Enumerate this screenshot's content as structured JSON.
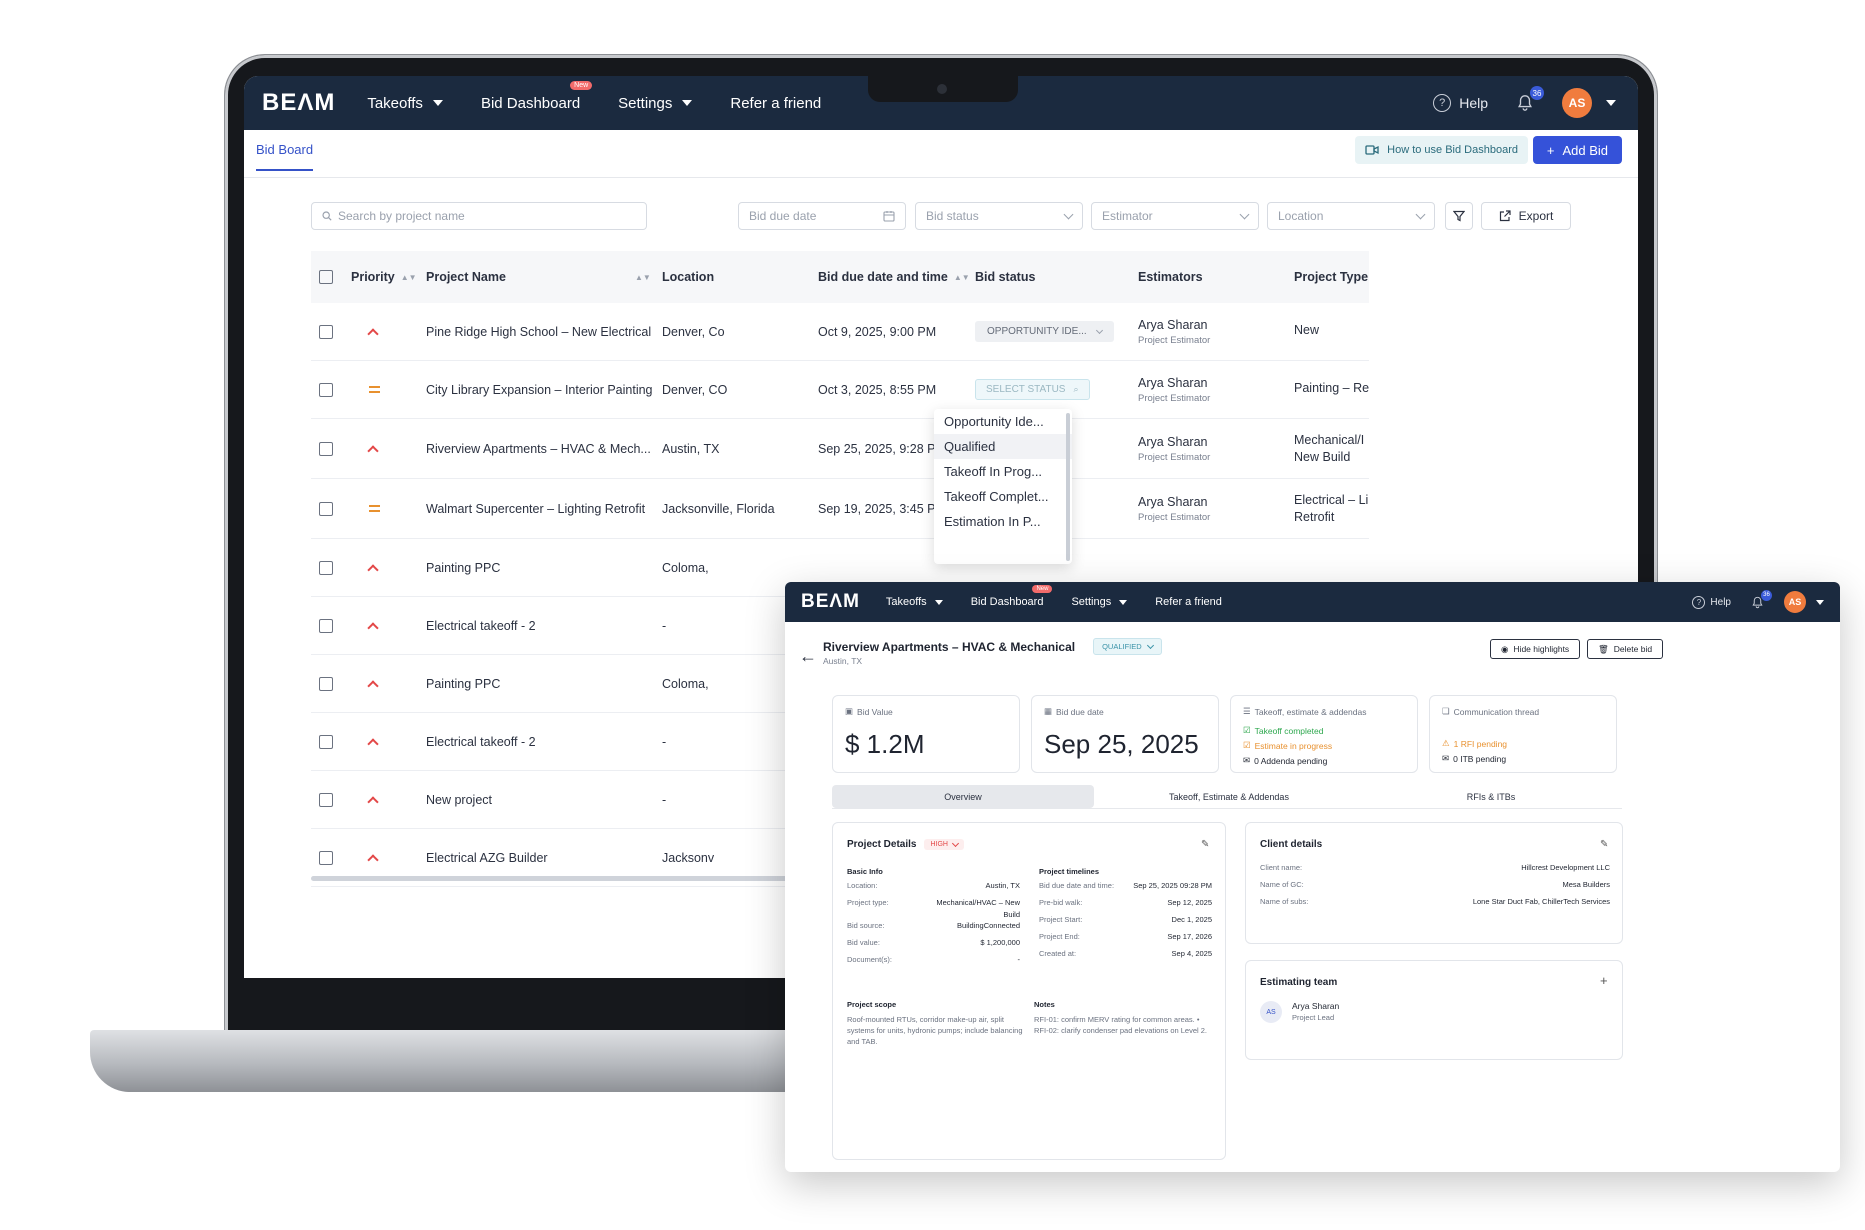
{
  "brand": {
    "logo": "BEΛM"
  },
  "nav": {
    "takeoffs": "Takeoffs",
    "bid_dashboard": "Bid Dashboard",
    "new_badge": "New",
    "settings": "Settings",
    "refer": "Refer a friend",
    "help": "Help",
    "help_glyph": "?",
    "notif_count": "36",
    "user_initials": "AS"
  },
  "subheader": {
    "tab": "Bid Board",
    "howto": "How to use Bid Dashboard",
    "add_bid": "Add Bid",
    "add_glyph": "+"
  },
  "filters": {
    "search_placeholder": "Search by project name",
    "bid_due_date": "Bid due date",
    "bid_status": "Bid status",
    "estimator": "Estimator",
    "location": "Location",
    "export": "Export"
  },
  "table": {
    "headers": {
      "priority": "Priority",
      "project_name": "Project Name",
      "location": "Location",
      "due": "Bid due date and time",
      "status": "Bid status",
      "estimators": "Estimators",
      "type": "Project Type"
    },
    "sort_glyph": "▲▼",
    "rows": [
      {
        "priority": "high",
        "name": "Pine Ridge High School – New Electrical",
        "location": "Denver, Co",
        "due": "Oct 9, 2025, 9:00 PM",
        "status": "OPPORTUNITY IDE...",
        "est_name": "Arya Sharan",
        "est_role": "Project Estimator",
        "type1": "New",
        "type2": ""
      },
      {
        "priority": "medium",
        "name": "City Library Expansion – Interior Painting",
        "location": "Denver, CO",
        "due": "Oct 3, 2025, 8:55 PM",
        "status": "SELECT STATUS",
        "est_name": "Arya Sharan",
        "est_role": "Project Estimator",
        "type1": "Painting – Re",
        "type2": ""
      },
      {
        "priority": "high",
        "name": "Riverview Apartments – HVAC & Mech...",
        "location": "Austin, TX",
        "due": "Sep 25, 2025, 9:28 PM",
        "status": "",
        "est_name": "Arya Sharan",
        "est_role": "Project Estimator",
        "type1": "Mechanical/I",
        "type2": "New Build"
      },
      {
        "priority": "medium",
        "name": "Walmart Supercenter – Lighting Retrofit",
        "location": "Jacksonville, Florida",
        "due": "Sep 19, 2025, 3:45 PM",
        "status": "",
        "est_name": "Arya Sharan",
        "est_role": "Project Estimator",
        "type1": "Electrical – Li",
        "type2": "Retrofit"
      },
      {
        "priority": "high",
        "name": "Painting PPC",
        "location": "Coloma,",
        "due": "",
        "status": "",
        "est_name": "",
        "est_role": "",
        "type1": "",
        "type2": ""
      },
      {
        "priority": "high",
        "name": "Electrical takeoff - 2",
        "location": "-",
        "due": "",
        "status": "",
        "est_name": "",
        "est_role": "",
        "type1": "",
        "type2": ""
      },
      {
        "priority": "high",
        "name": "Painting PPC",
        "location": "Coloma,",
        "due": "",
        "status": "",
        "est_name": "",
        "est_role": "",
        "type1": "",
        "type2": ""
      },
      {
        "priority": "high",
        "name": "Electrical takeoff - 2",
        "location": "-",
        "due": "",
        "status": "",
        "est_name": "",
        "est_role": "",
        "type1": "",
        "type2": ""
      },
      {
        "priority": "high",
        "name": "New project",
        "location": "-",
        "due": "",
        "status": "",
        "est_name": "",
        "est_role": "",
        "type1": "",
        "type2": ""
      },
      {
        "priority": "high",
        "name": "Electrical AZG Builder",
        "location": "Jacksonv",
        "due": "",
        "status": "",
        "est_name": "",
        "est_role": "",
        "type1": "",
        "type2": ""
      }
    ]
  },
  "status_dropdown": {
    "options": [
      "Opportunity Ide...",
      "Qualified",
      "Takeoff In Prog...",
      "Takeoff Complet...",
      "Estimation In P..."
    ],
    "selected": "Qualified"
  },
  "detail": {
    "title": "Riverview Apartments – HVAC & Mechanical",
    "status": "QUALIFIED",
    "location": "Austin, TX",
    "hide_highlights": "Hide highlights",
    "delete_bid": "Delete bid",
    "bid_value_label": "Bid Value",
    "bid_value": "$ 1.2M",
    "due_label": "Bid due date",
    "due_value": "Sep 25, 2025",
    "takeoff_label": "Takeoff, estimate & addendas",
    "takeoff_completed": "Takeoff completed",
    "estimate_progress": "Estimate in progress",
    "addenda_pending": "0 Addenda pending",
    "comm_label": "Communication thread",
    "rfi_pending": "1 RFI pending",
    "itb_pending": "0 ITB pending",
    "tabs": [
      "Overview",
      "Takeoff, Estimate & Addendas",
      "RFIs & ITBs"
    ],
    "project_details": "Project Details",
    "priority": "HIGH",
    "basic_info": "Basic Info",
    "basic": [
      {
        "k": "Location:",
        "v": "Austin, TX"
      },
      {
        "k": "Project type:",
        "v": "Mechanical/HVAC – New"
      },
      {
        "k": "",
        "v": "Build"
      },
      {
        "k": "Bid source:",
        "v": "BuildingConnected"
      },
      {
        "k": "Bid value:",
        "v": "$ 1,200,000"
      },
      {
        "k": "Document(s):",
        "v": "-"
      }
    ],
    "timelines_title": "Project timelines",
    "timelines": [
      {
        "k": "Bid due date and time:",
        "v": "Sep 25, 2025 09:28 PM"
      },
      {
        "k": "Pre-bid walk:",
        "v": "Sep 12, 2025"
      },
      {
        "k": "Project Start:",
        "v": "Dec 1, 2025"
      },
      {
        "k": "Project End:",
        "v": "Sep 17, 2026"
      },
      {
        "k": "Created at:",
        "v": "Sep 4, 2025"
      }
    ],
    "scope_title": "Project scope",
    "scope": "Roof-mounted RTUs, corridor make-up air, split systems for units, hydronic pumps; include balancing and TAB.",
    "notes_title": "Notes",
    "notes": "RFI-01: confirm MERV rating for common areas. • RFI-02: clarify condenser pad elevations on Level 2.",
    "client_title": "Client details",
    "client": [
      {
        "k": "Client name:",
        "v": "Hillcrest Development LLC"
      },
      {
        "k": "Name of GC:",
        "v": "Mesa Builders"
      },
      {
        "k": "Name of subs:",
        "v": "Lone Star Duct Fab, ChillerTech Services"
      }
    ],
    "team_title": "Estimating team",
    "team_add": "+",
    "member_initials": "AS",
    "member_name": "Arya Sharan",
    "member_role": "Project Lead"
  },
  "colors": {
    "navy": "#1b2a3f",
    "accent": "#3552d9",
    "priority_high": "#e34848",
    "priority_medium": "#e8912f",
    "avatar": "#f07c3e"
  }
}
